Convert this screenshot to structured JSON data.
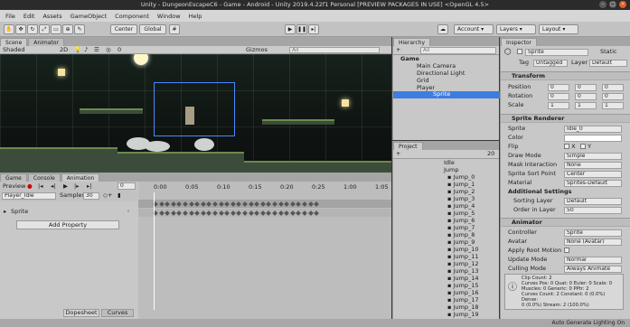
{
  "window": {
    "title": "Unity - DungeonEscapeC6 - Game - Android - Unity 2019.4.22f1 Personal [PREVIEW PACKAGES IN USE] <OpenGL 4.5>"
  },
  "menu": [
    "File",
    "Edit",
    "Assets",
    "GameObject",
    "Component",
    "Window",
    "Help"
  ],
  "toolbar": {
    "pivot": "Center",
    "space": "Global",
    "account": "Account",
    "layers": "Layers",
    "layout": "Layout",
    "collab_icon": "cloud-icon"
  },
  "scene_view": {
    "tabs": [
      "Scene",
      "Animator"
    ],
    "shading": "Shaded",
    "mode_2d": "2D",
    "gizmos": "Gizmos",
    "search_placeholder": "All",
    "counter": "0"
  },
  "hierarchy": {
    "title": "Hierarchy",
    "create": "+",
    "search_placeholder": "All",
    "scene": "Game",
    "items": [
      "Main Camera",
      "Directional Light",
      "Grid",
      "Player",
      "Sprite"
    ]
  },
  "project": {
    "title": "Project",
    "create": "+",
    "count": "20",
    "folders": [
      "Idle",
      "Jump"
    ],
    "files": [
      "Jump_0",
      "Jump_1",
      "Jump_2",
      "Jump_3",
      "Jump_4",
      "Jump_5",
      "Jump_6",
      "Jump_7",
      "Jump_8",
      "Jump_9",
      "Jump_10",
      "Jump_11",
      "Jump_12",
      "Jump_13",
      "Jump_14",
      "Jump_15",
      "Jump_16",
      "Jump_17",
      "Jump_18",
      "Jump_19"
    ]
  },
  "animation": {
    "tabs": [
      "Game",
      "Console",
      "Animation"
    ],
    "preview": "Preview",
    "frame": "0",
    "clip": "Player_Idle",
    "samples_label": "Samples",
    "samples": "30",
    "property": "Sprite",
    "add_property": "Add Property",
    "ticks": [
      "0:00",
      "0:05",
      "0:10",
      "0:15",
      "0:20",
      "0:25",
      "1:00",
      "1:05"
    ],
    "bottom_tabs": [
      "Dopesheet",
      "Curves"
    ]
  },
  "inspector": {
    "title": "Inspector",
    "object_name": "Sprite",
    "static": "Static",
    "tag_label": "Tag",
    "tag": "Untagged",
    "layer_label": "Layer",
    "layer": "Default",
    "transform": {
      "title": "Transform",
      "position": {
        "label": "Position",
        "x": "0",
        "y": "0",
        "z": "0"
      },
      "rotation": {
        "label": "Rotation",
        "x": "0",
        "y": "0",
        "z": "0"
      },
      "scale": {
        "label": "Scale",
        "x": "1",
        "y": "1",
        "z": "1"
      }
    },
    "sprite_renderer": {
      "title": "Sprite Renderer",
      "sprite_label": "Sprite",
      "sprite": "Idle_0",
      "color_label": "Color",
      "flip_label": "Flip",
      "flip_x": "X",
      "flip_y": "Y",
      "draw_mode_label": "Draw Mode",
      "draw_mode": "Simple",
      "mask_label": "Mask Interaction",
      "mask": "None",
      "sort_point_label": "Sprite Sort Point",
      "sort_point": "Center",
      "material_label": "Material",
      "material": "Sprites-Default",
      "additional": "Additional Settings",
      "sorting_layer_label": "Sorting Layer",
      "sorting_layer": "Default",
      "order_label": "Order in Layer",
      "order": "50"
    },
    "animator": {
      "title": "Animator",
      "controller_label": "Controller",
      "controller": "Sprite",
      "avatar_label": "Avatar",
      "avatar": "None (Avatar)",
      "root_motion_label": "Apply Root Motion",
      "update_label": "Update Mode",
      "update": "Normal",
      "culling_label": "Culling Mode",
      "culling": "Always Animate",
      "info": [
        "Clip Count: 2",
        "Curves Pos: 0 Quat: 0 Euler: 0 Scale: 0",
        "Muscles: 0 Generic: 0 PPtr: 2",
        "Curves Count: 2 Constant: 0 (0.0%) Dense:",
        "0 (0.0%) Stream: 2 (100.0%)"
      ]
    }
  },
  "status": {
    "right": "Auto Generate Lighting On"
  }
}
